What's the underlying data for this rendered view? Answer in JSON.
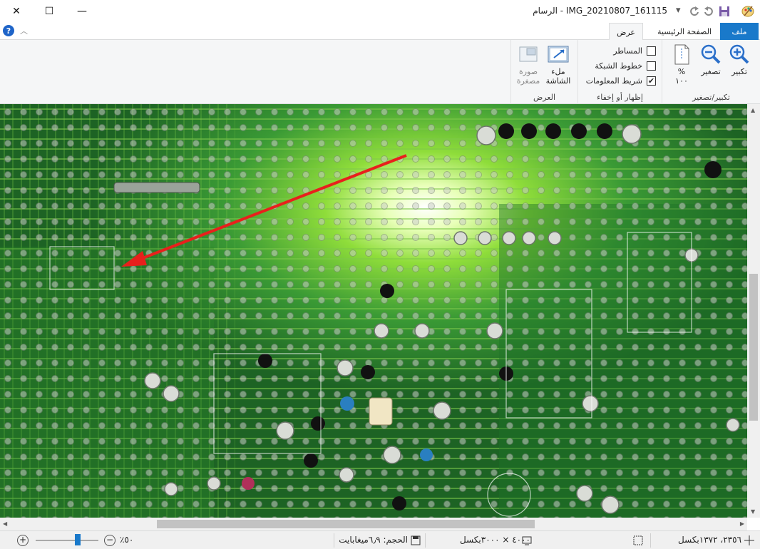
{
  "window": {
    "title": "IMG_20210807_161115 - الرسام",
    "minimize_glyph": "—",
    "maximize_glyph": "☐",
    "close_glyph": "✕"
  },
  "quick_access": {
    "save_icon": "save-icon",
    "undo_icon": "undo-icon",
    "redo_icon": "redo-icon",
    "customize_glyph": "▾"
  },
  "ribbon": {
    "tabs": [
      {
        "label": "ملف"
      },
      {
        "label": "الصفحة الرئيسية"
      },
      {
        "label": "عرض"
      }
    ],
    "help_glyph": "?",
    "collapse_glyph": "︿",
    "groups": {
      "zoom": {
        "label": "تكبير/تصغير",
        "zoom_in": "تكبير",
        "zoom_out": "تصغير",
        "percent": "%",
        "percent_value": "١٠٠"
      },
      "show_hide": {
        "label": "إظهار أو إخفاء",
        "rulers": "المساطر",
        "gridlines": "خطوط الشبكة",
        "status_bar": "شريط المعلومات",
        "rulers_checked": false,
        "gridlines_checked": false,
        "status_bar_checked": true,
        "check_glyph": "✔"
      },
      "display": {
        "label": "العرض",
        "full_screen_line1": "ملء",
        "full_screen_line2": "الشاشة",
        "thumbnail_line1": "صورة",
        "thumbnail_line2": "مصغرة"
      }
    }
  },
  "status": {
    "position": "٢٣٥٦، ١٣٧٢بكسل",
    "dimensions": "٤٠٠٠ × ٣٠٠٠بكسل",
    "size": "الحجم: ٦٫٩ميغابايت",
    "zoom": "٥٠٪",
    "zoom_level": 0.5
  },
  "colors": {
    "accent": "#1979ca",
    "pcb_green": "#3a9a35",
    "arrow_red": "#e8201c"
  }
}
